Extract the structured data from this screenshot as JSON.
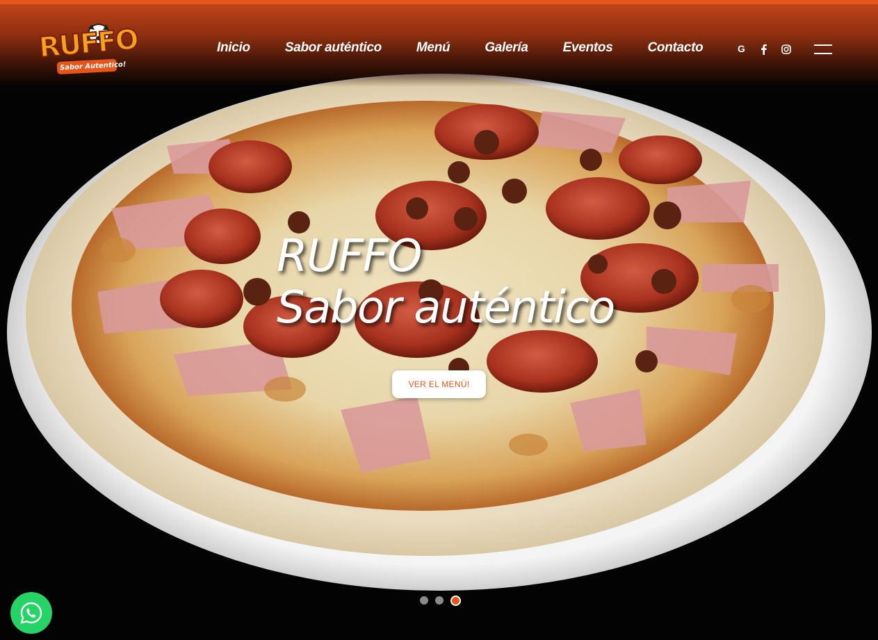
{
  "brand": {
    "name": "RUFFO",
    "tagline": "Sabor Autentico!",
    "accent_color": "#e8551b",
    "logo_color": "#f5a21c"
  },
  "nav": {
    "items": [
      {
        "label": "Inicio"
      },
      {
        "label": "Sabor auténtico"
      },
      {
        "label": "Menú"
      },
      {
        "label": "Galería"
      },
      {
        "label": "Eventos"
      },
      {
        "label": "Contacto"
      }
    ]
  },
  "social": {
    "icons": [
      "google-icon",
      "facebook-icon",
      "instagram-icon"
    ],
    "google_glyph": "G"
  },
  "hero": {
    "title_line1": "RUFFO",
    "title_line2": "Sabor auténtico",
    "cta_label": "VER EL MENÚ!",
    "background": "pizza-photo"
  },
  "slider": {
    "total_slides": 3,
    "active_slide": 3
  },
  "whatsapp": {
    "icon": "whatsapp-icon",
    "color": "#25d366"
  }
}
